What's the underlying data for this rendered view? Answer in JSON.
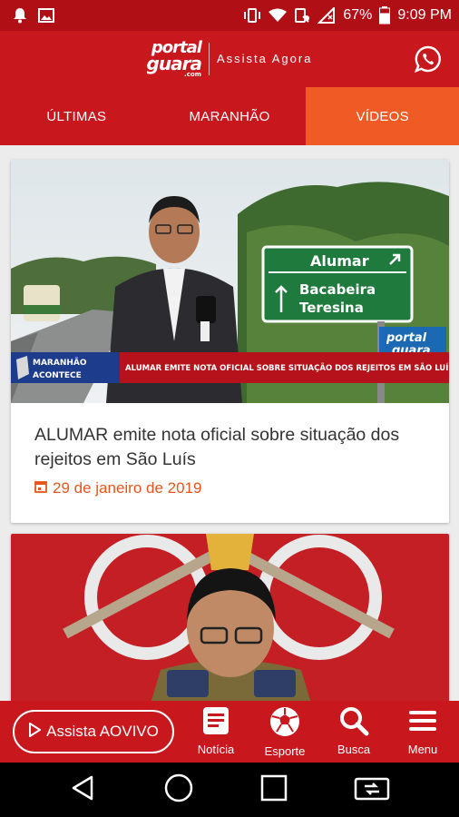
{
  "status_bar": {
    "battery": "67%",
    "time": "9:09 PM"
  },
  "header": {
    "logo_line1": "portal",
    "logo_line2": "guara",
    "logo_line3": ".com",
    "tagline": "Assista Agora"
  },
  "tabs": [
    {
      "label": "ÚLTIMAS"
    },
    {
      "label": "MARANHÃO"
    },
    {
      "label": "VÍDEOS"
    }
  ],
  "articles": [
    {
      "title": "ALUMAR emite nota oficial sobre situação dos rejeitos em São Luís",
      "date": "29 de janeiro de 2019",
      "image": {
        "road_sign_top": "Alumar",
        "road_sign_mid": "Bacabeira",
        "road_sign_bot": "Teresina",
        "program_tag_1": "MARANHÃO",
        "program_tag_2": "ACONTECE",
        "ticker": "ALUMAR EMITE NOTA OFICIAL SOBRE SITUAÇÃO DOS REJEITOS EM SÃO LUÍS",
        "watermark_1": "portal",
        "watermark_2": "guara"
      }
    }
  ],
  "bottom_nav": {
    "live_button": "Assista AOVIVO",
    "items": [
      {
        "label": "Notícia",
        "icon": "news-icon"
      },
      {
        "label": "Esporte",
        "icon": "soccer-ball-icon"
      },
      {
        "label": "Busca",
        "icon": "search-icon"
      },
      {
        "label": "Menu",
        "icon": "menu-icon"
      }
    ]
  },
  "colors": {
    "brand_red": "#c8171d",
    "active_tab": "#f05a24",
    "date": "#e8541c"
  }
}
